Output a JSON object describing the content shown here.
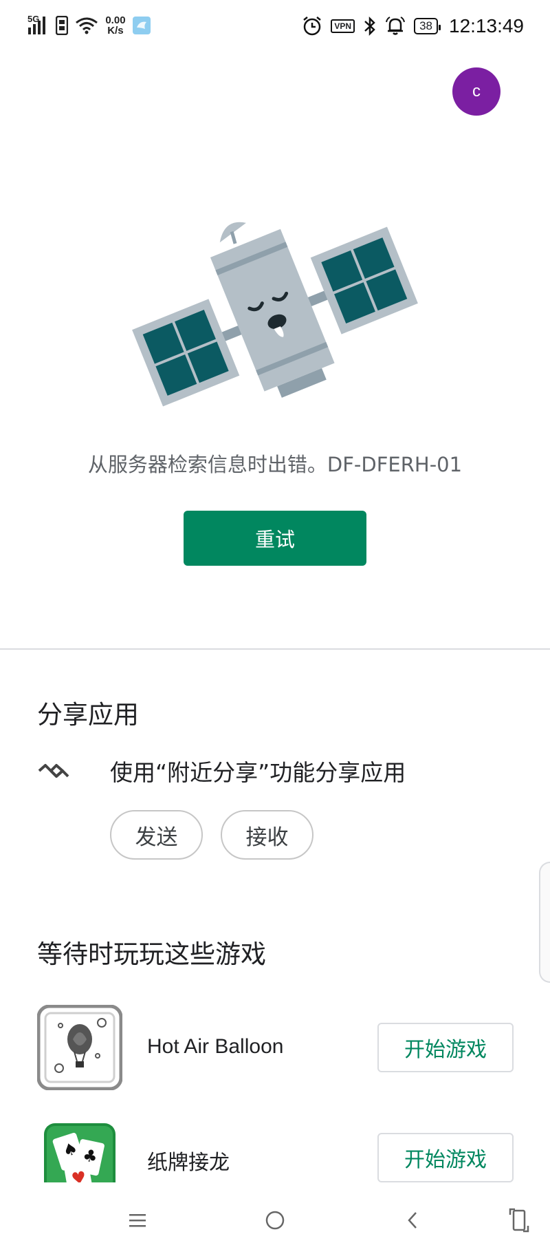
{
  "status_bar": {
    "network_type": "5G",
    "net_speed_value": "0.00",
    "net_speed_unit": "K/s",
    "vpn_label": "VPN",
    "battery_level": "38",
    "time": "12:13:49"
  },
  "account": {
    "avatar_initial": "c",
    "avatar_color": "#7b1fa2"
  },
  "error": {
    "message": "从服务器检索信息时出错。DF-DFERH-01",
    "retry_label": "重试",
    "illustration": "sleeping-satellite"
  },
  "share_section": {
    "title": "分享应用",
    "nearby_share_text": "使用“附近分享”功能分享应用",
    "send_label": "发送",
    "receive_label": "接收"
  },
  "games_section": {
    "title": "等待时玩玩这些游戏",
    "games": [
      {
        "name": "Hot Air Balloon",
        "play_label": "开始游戏",
        "icon": "hot-air-balloon-icon"
      },
      {
        "name": "纸牌接龙",
        "play_label": "开始游戏",
        "icon": "solitaire-icon"
      }
    ]
  },
  "navigation": {
    "buttons": [
      "menu",
      "home",
      "back",
      "rotate"
    ]
  },
  "colors": {
    "accent": "#01875f",
    "satellite_panel": "#0b5a62",
    "satellite_body": "#b4bfc7"
  }
}
